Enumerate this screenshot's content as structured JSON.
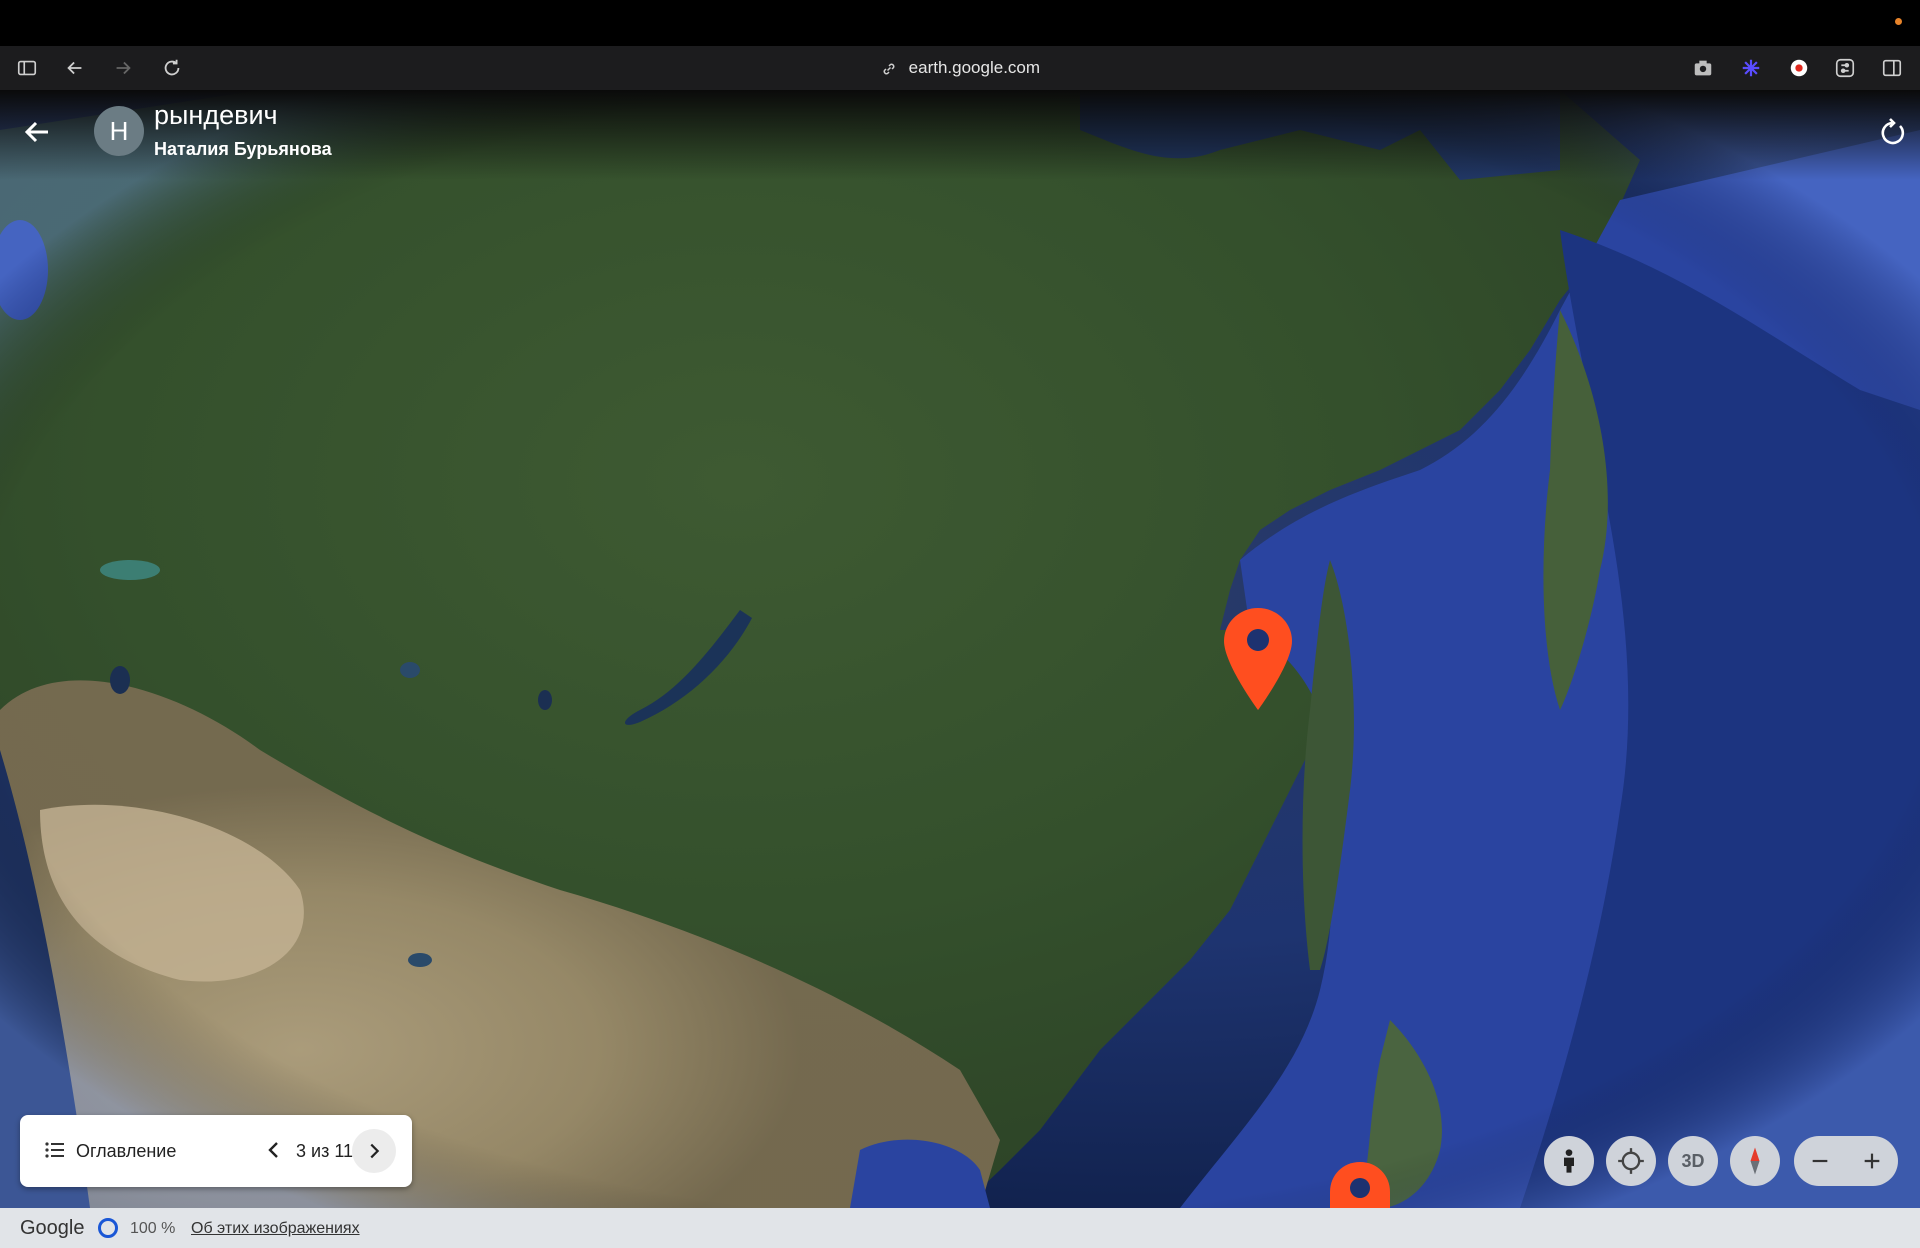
{
  "browser": {
    "url": "earth.google.com",
    "icons": [
      "sidebar-icon",
      "back-arrow-icon",
      "forward-arrow-icon",
      "reload-icon",
      "link-icon",
      "camera-icon",
      "extension-icon",
      "record-icon",
      "settings-icon",
      "split-view-icon"
    ]
  },
  "header": {
    "title": "рындевич",
    "author": "Наталия Бурьянова",
    "avatar_letter": "Н"
  },
  "toc": {
    "label": "Оглавление",
    "counter": "3 из 11"
  },
  "controls": {
    "three_d_label": "3D"
  },
  "status_bar": {
    "logo": "Google",
    "load_percent": "100 %",
    "about_link": "Об этих изображениях"
  },
  "colors": {
    "pin": "#ff4e1f",
    "ocean": "#1e3470",
    "land": "#3a5230",
    "desert": "#9a8a68"
  }
}
